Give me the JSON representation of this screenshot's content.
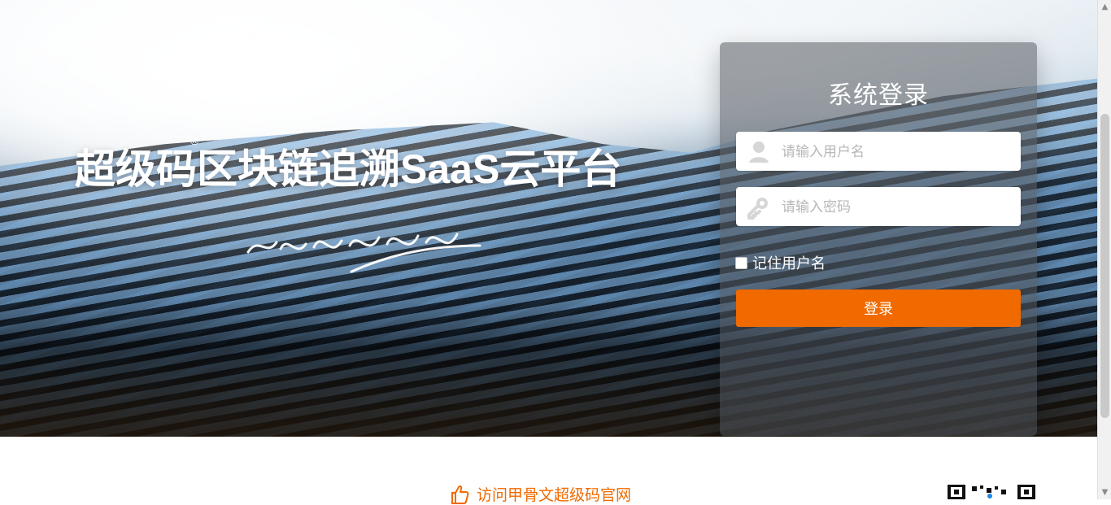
{
  "hero": {
    "title": "超级码区块链追溯SaaS云平台",
    "registered_mark": "®"
  },
  "login": {
    "title": "系统登录",
    "username_placeholder": "请输入用户名",
    "password_placeholder": "请输入密码",
    "remember_label": "记住用户名",
    "submit_label": "登录"
  },
  "footer": {
    "link_text": "访问甲骨文超级码官网"
  },
  "colors": {
    "accent": "#f06a00"
  },
  "icons": {
    "username": "user-icon",
    "password": "key-icon",
    "footer_link": "thumbs-up-icon",
    "qr": "qr-code-icon"
  }
}
